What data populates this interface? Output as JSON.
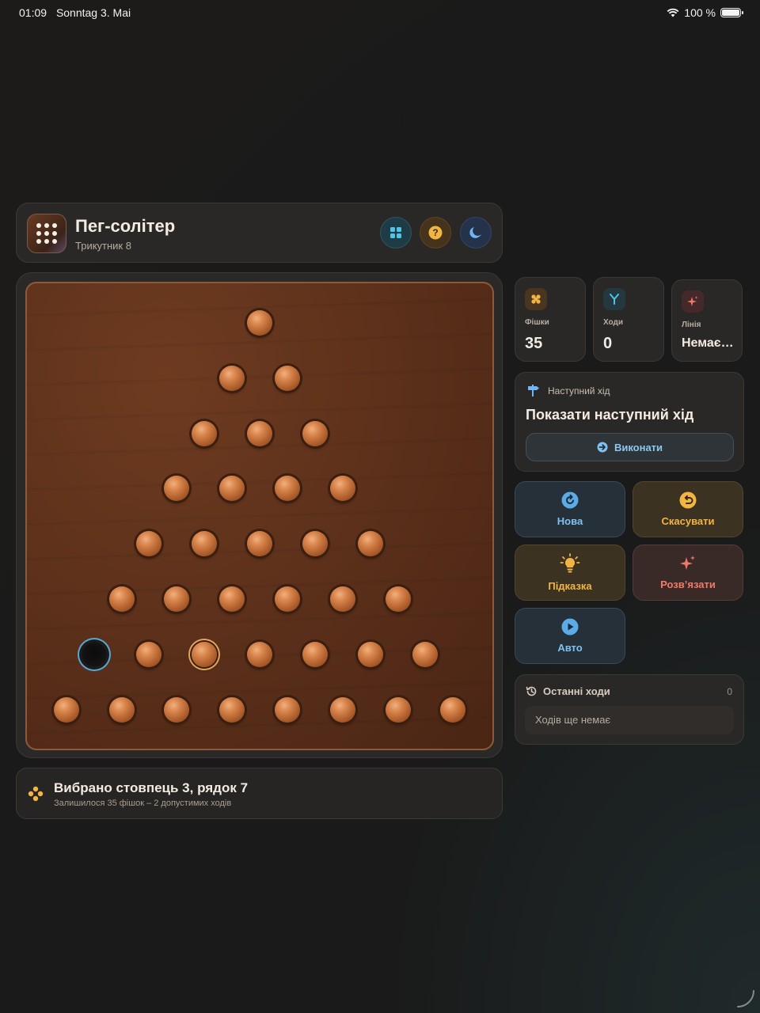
{
  "status_bar": {
    "time": "01:09",
    "date": "Sonntag 3. Mai",
    "battery": "100 %",
    "battery_level": 1.0
  },
  "header": {
    "title": "Пег-солітер",
    "subtitle": "Трикутник 8",
    "icons": {
      "app": "dots-grid-icon",
      "grid": "grid-icon",
      "help": "help-icon",
      "theme": "moon-icon"
    }
  },
  "board": {
    "shape": "triangle",
    "rows": 8,
    "empty_holes": [
      {
        "col": 1,
        "row": 7
      }
    ],
    "selected": {
      "col": 3,
      "row": 7
    }
  },
  "status": {
    "title": "Вибрано стовпець 3, рядок 7",
    "subtitle": "Залишилося 35 фішок – 2 допустимих ходів"
  },
  "stats": [
    {
      "label": "Фішки",
      "value": "35",
      "icon": "pegs-icon"
    },
    {
      "label": "Ходи",
      "value": "0",
      "icon": "fork-icon"
    },
    {
      "label": "Лінія",
      "value": "Немає…",
      "icon": "sparkle-icon"
    }
  ],
  "next_move": {
    "label": "Наступний хід",
    "title": "Показати наступний хід",
    "button": "Виконати"
  },
  "actions": {
    "new": "Нова",
    "undo": "Скасувати",
    "hint": "Підказка",
    "solve": "Розв’язати",
    "auto": "Авто"
  },
  "recent": {
    "title": "Останні ходи",
    "count": "0",
    "empty": "Ходів ще немає"
  },
  "colors": {
    "background": "#1c1b1a",
    "board": "#5a2f1a",
    "peg": "#c7733c",
    "accent_blue": "#7fc1f0",
    "accent_amber": "#f2b544",
    "accent_red": "#f07a6a"
  }
}
